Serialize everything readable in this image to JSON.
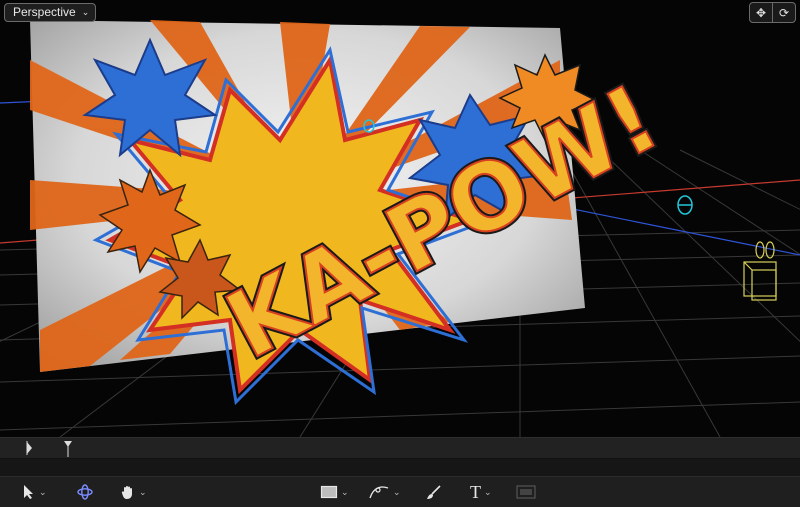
{
  "viewer": {
    "view_mode": "Perspective",
    "icons": [
      "chevron-down-icon",
      "move-view-icon",
      "orbit-view-icon"
    ]
  },
  "scene": {
    "title_text": "KA-POW!",
    "colors": {
      "orange": "#e0661a",
      "blue": "#2e6fd6",
      "yellow": "#f0b81e",
      "grid": "#3a3a3a",
      "camera": "#d8d05a",
      "light": "#23c7d8"
    }
  },
  "toolbar": {
    "icons": [
      "select-arrow-icon",
      "transform-3d-icon",
      "pan-hand-icon",
      "rectangle-shape-icon",
      "pen-bezier-icon",
      "paintbrush-icon",
      "text-tool-icon",
      "mask-icon"
    ],
    "text_tool_label": "T"
  }
}
